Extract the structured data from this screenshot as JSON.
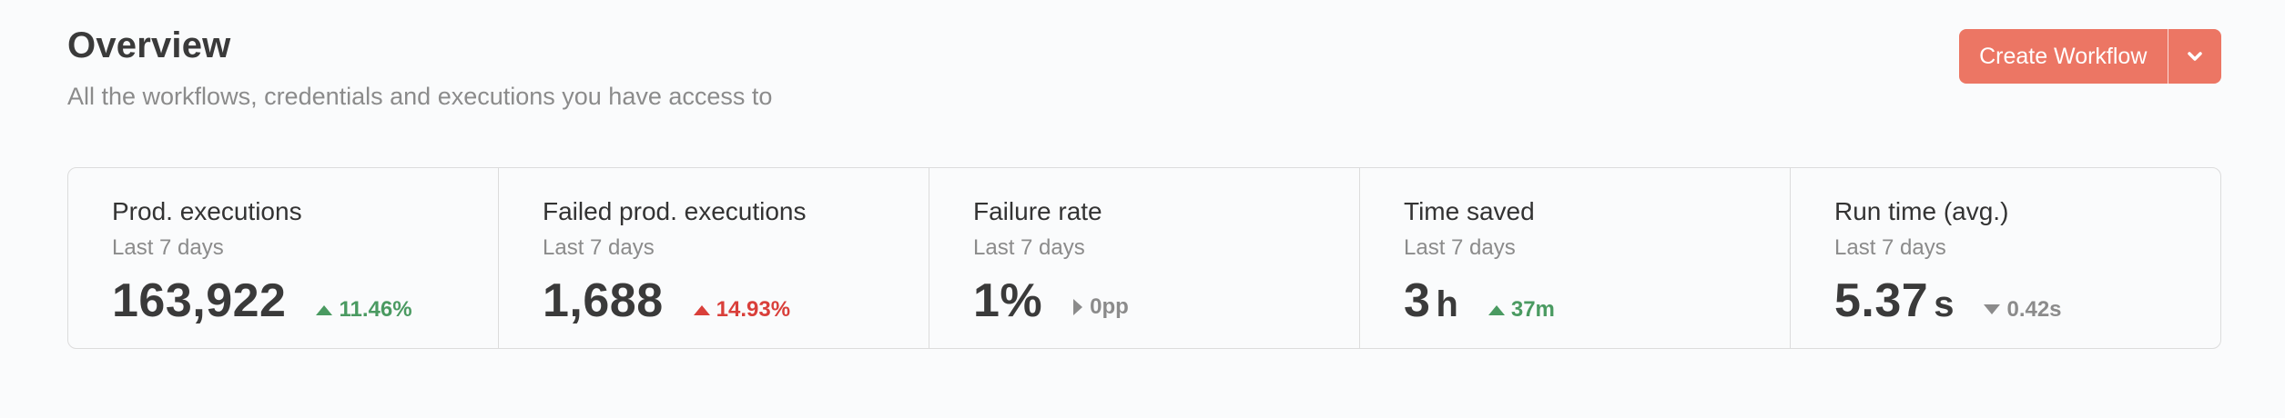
{
  "header": {
    "title": "Overview",
    "subtitle": "All the workflows, credentials and executions you have access to"
  },
  "create_button": {
    "label": "Create Workflow",
    "dropdown_icon": "chevron-down-icon"
  },
  "colors": {
    "accent": "#ec7664",
    "positive": "#4a9a61",
    "negative": "#d93f3a",
    "neutral": "#8b8b8b"
  },
  "stats": [
    {
      "label": "Prod. executions",
      "period": "Last 7 days",
      "value": "163,922",
      "unit": "",
      "trend": "11.46%",
      "trend_icon": "triangle-up-icon"
    },
    {
      "label": "Failed prod. executions",
      "period": "Last 7 days",
      "value": "1,688",
      "unit": "",
      "trend": "14.93%",
      "trend_icon": "triangle-up-icon"
    },
    {
      "label": "Failure rate",
      "period": "Last 7 days",
      "value": "1%",
      "unit": "",
      "trend": "0pp",
      "trend_icon": "triangle-right-icon"
    },
    {
      "label": "Time saved",
      "period": "Last 7 days",
      "value": "3",
      "unit": "h",
      "trend": "37m",
      "trend_icon": "triangle-up-icon"
    },
    {
      "label": "Run time (avg.)",
      "period": "Last 7 days",
      "value": "5.37",
      "unit": "s",
      "trend": "0.42s",
      "trend_icon": "triangle-down-icon"
    }
  ]
}
